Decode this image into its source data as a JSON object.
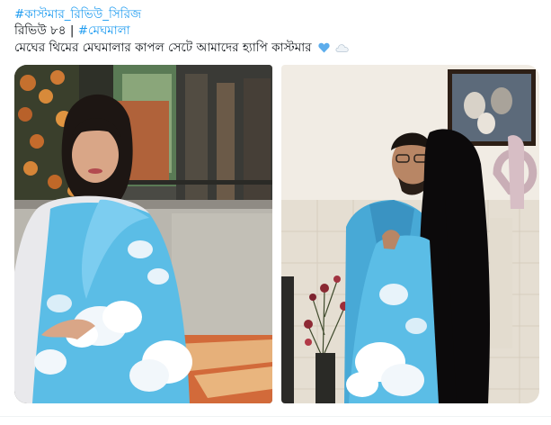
{
  "post": {
    "hashtag_line": "#কাস্টমার_রিভিউ_সিরিজ",
    "review_label": "রিভিউ ৮৪",
    "separator": " | ",
    "product_hashtag": "#মেঘমালা",
    "caption": "মেঘের থিমের মেঘমালার কাপল সেটে আমাদের হ্যাপি কাস্টমার",
    "emojis": [
      "blue-heart-icon",
      "cloud-icon"
    ]
  },
  "photos": [
    {
      "name": "photo-woman-saree",
      "alt": "woman in sky blue cloud print saree"
    },
    {
      "name": "photo-couple",
      "alt": "couple in matching cloud print outfits"
    }
  ],
  "colors": {
    "link": "#1d9bf0",
    "saree_blue": "#5bbde6",
    "text": "#0f1419"
  }
}
